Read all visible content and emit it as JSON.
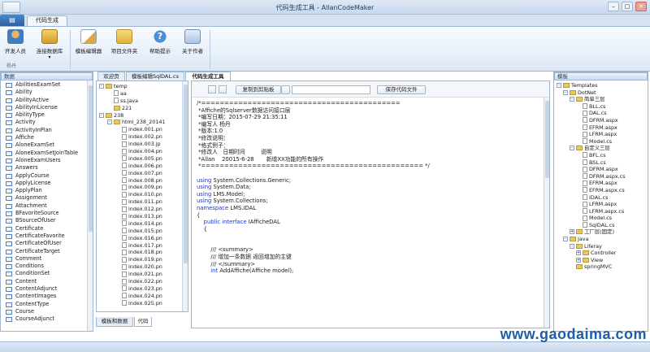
{
  "window": {
    "title": "代码生成工具 - AllanCodeMaker",
    "min": "–",
    "max": "□",
    "close": "✕"
  },
  "ribbon": {
    "tab": "代码生成",
    "buttons": [
      "开发人员",
      "连接数据库",
      "模板编辑器",
      "项目文件夹",
      "帮助提示",
      "关于作者"
    ],
    "group_label": "杨丹"
  },
  "left_panel": {
    "title": "数据",
    "items": [
      "AbilitiesExamSet",
      "Ability",
      "AbilityActive",
      "AbilityInLicense",
      "AbilityType",
      "Activity",
      "ActivityInPlan",
      "Affiche",
      "AloneExamSet",
      "AloneExamSetJoinTable",
      "AloneExamUsers",
      "Answers",
      "ApplyCourse",
      "ApplyLicense",
      "ApplyPlan",
      "Assignment",
      "Attachment",
      "BFavoriteSource",
      "BSourceOfUser",
      "Certificate",
      "CertificateFavorite",
      "CertificateOfUser",
      "CertificateTarget",
      "Comment",
      "Conditions",
      "ConditionSet",
      "Content",
      "ContentAdjunct",
      "ContentImages",
      "ContentType",
      "Course",
      "CourseAdjunct"
    ]
  },
  "doc_tabs": [
    "欢迎页",
    "模板编辑SqlDAL.cs",
    "代码生成工具"
  ],
  "file_tree": {
    "items": [
      {
        "label": "temp",
        "indent": 0,
        "kind": "folder",
        "exp": "-"
      },
      {
        "label": "aa",
        "indent": 1,
        "kind": "file",
        "exp": ""
      },
      {
        "label": "ss.java",
        "indent": 1,
        "kind": "file",
        "exp": ""
      },
      {
        "label": "221",
        "indent": 1,
        "kind": "folder",
        "exp": ""
      },
      {
        "label": "238",
        "indent": 0,
        "kind": "folder",
        "exp": "-"
      },
      {
        "label": "html_238_20141",
        "indent": 1,
        "kind": "folder",
        "exp": "-"
      },
      {
        "label": "index.001.pn",
        "indent": 2,
        "kind": "file",
        "exp": ""
      },
      {
        "label": "index.002.pn",
        "indent": 2,
        "kind": "file",
        "exp": ""
      },
      {
        "label": "index.003.jp",
        "indent": 2,
        "kind": "file",
        "exp": ""
      },
      {
        "label": "index.004.pn",
        "indent": 2,
        "kind": "file",
        "exp": ""
      },
      {
        "label": "index.005.pn",
        "indent": 2,
        "kind": "file",
        "exp": ""
      },
      {
        "label": "index.006.pn",
        "indent": 2,
        "kind": "file",
        "exp": ""
      },
      {
        "label": "index.007.pn",
        "indent": 2,
        "kind": "file",
        "exp": ""
      },
      {
        "label": "index.008.pn",
        "indent": 2,
        "kind": "file",
        "exp": ""
      },
      {
        "label": "index.009.pn",
        "indent": 2,
        "kind": "file",
        "exp": ""
      },
      {
        "label": "index.010.pn",
        "indent": 2,
        "kind": "file",
        "exp": ""
      },
      {
        "label": "index.011.pn",
        "indent": 2,
        "kind": "file",
        "exp": ""
      },
      {
        "label": "index.012.pn",
        "indent": 2,
        "kind": "file",
        "exp": ""
      },
      {
        "label": "index.013.pn",
        "indent": 2,
        "kind": "file",
        "exp": ""
      },
      {
        "label": "index.014.pn",
        "indent": 2,
        "kind": "file",
        "exp": ""
      },
      {
        "label": "index.015.pn",
        "indent": 2,
        "kind": "file",
        "exp": ""
      },
      {
        "label": "index.016.pn",
        "indent": 2,
        "kind": "file",
        "exp": ""
      },
      {
        "label": "index.017.pn",
        "indent": 2,
        "kind": "file",
        "exp": ""
      },
      {
        "label": "index.018.pn",
        "indent": 2,
        "kind": "file",
        "exp": ""
      },
      {
        "label": "index.019.pn",
        "indent": 2,
        "kind": "file",
        "exp": ""
      },
      {
        "label": "index.020.pn",
        "indent": 2,
        "kind": "file",
        "exp": ""
      },
      {
        "label": "index.021.pn",
        "indent": 2,
        "kind": "file",
        "exp": ""
      },
      {
        "label": "index.022.pn",
        "indent": 2,
        "kind": "file",
        "exp": ""
      },
      {
        "label": "index.023.pn",
        "indent": 2,
        "kind": "file",
        "exp": ""
      },
      {
        "label": "index.024.pn",
        "indent": 2,
        "kind": "file",
        "exp": ""
      },
      {
        "label": "index.025.pn",
        "indent": 2,
        "kind": "file",
        "exp": ""
      }
    ]
  },
  "editor_toolbar": {
    "copy_label": "复制到剪贴板",
    "save_label": "保存代码文件",
    "input_value": ""
  },
  "code_lines": [
    {
      "t": "/*===========================================",
      "c": "plain"
    },
    {
      "t": " *Affiche的Sqlserver数据访问接口层",
      "c": "plain"
    },
    {
      "t": " *编写日期：2015-07-29 21:35:11",
      "c": "plain"
    },
    {
      "t": " *编写人 杨丹",
      "c": "plain"
    },
    {
      "t": " *版本:1.0",
      "c": "plain"
    },
    {
      "t": " *修改说明：",
      "c": "plain"
    },
    {
      "t": " *格式例子：",
      "c": "plain"
    },
    {
      "t": " *修改人   日期时间         说明",
      "c": "plain"
    },
    {
      "t": " *Allan    20015-6-28       新增XX功能的所有操作",
      "c": "plain"
    },
    {
      "t": " *================================================ */",
      "c": "plain"
    },
    {
      "t": "",
      "c": "plain"
    },
    {
      "t": "using System.Collections.Generic;",
      "c": "using"
    },
    {
      "t": "using System.Data;",
      "c": "using"
    },
    {
      "t": "using LMS.Model;",
      "c": "using"
    },
    {
      "t": "using System.Collections;",
      "c": "using"
    },
    {
      "t": "namespace LMS.IDAL",
      "c": "ns"
    },
    {
      "t": "{",
      "c": "plain"
    },
    {
      "t": "    public interface IAfficheDAL",
      "c": "iface"
    },
    {
      "t": "    {",
      "c": "plain"
    },
    {
      "t": "",
      "c": "plain"
    },
    {
      "t": "",
      "c": "plain"
    },
    {
      "t": "        /// <summary>",
      "c": "plain"
    },
    {
      "t": "        /// 增加一条数据 返回增加的主键",
      "c": "plain"
    },
    {
      "t": "        /// </summary>",
      "c": "plain"
    },
    {
      "t": "        int AddAffiche(Affiche model);",
      "c": "int"
    }
  ],
  "bottom_tabs": [
    "模板和数据",
    "代码"
  ],
  "right_panel": {
    "title": "模板",
    "items": [
      {
        "label": "Templates",
        "indent": 0,
        "kind": "folder",
        "exp": "-"
      },
      {
        "label": "DotNet",
        "indent": 1,
        "kind": "folder",
        "exp": "-"
      },
      {
        "label": "简单三层",
        "indent": 2,
        "kind": "folder",
        "exp": "-"
      },
      {
        "label": "BLL.cs",
        "indent": 3,
        "kind": "file",
        "exp": ""
      },
      {
        "label": "DAL.cs",
        "indent": 3,
        "kind": "file",
        "exp": ""
      },
      {
        "label": "DFRM.aspx",
        "indent": 3,
        "kind": "file",
        "exp": ""
      },
      {
        "label": "EFRM.aspx",
        "indent": 3,
        "kind": "file",
        "exp": ""
      },
      {
        "label": "LFRM.aspx",
        "indent": 3,
        "kind": "file",
        "exp": ""
      },
      {
        "label": "Model.cs",
        "indent": 3,
        "kind": "file",
        "exp": ""
      },
      {
        "label": "自定义三层",
        "indent": 2,
        "kind": "folder",
        "exp": "-"
      },
      {
        "label": "BFL.cs",
        "indent": 3,
        "kind": "file",
        "exp": ""
      },
      {
        "label": "BSL.cs",
        "indent": 3,
        "kind": "file",
        "exp": ""
      },
      {
        "label": "DFRM.aspx",
        "indent": 3,
        "kind": "file",
        "exp": ""
      },
      {
        "label": "DFRM.aspx.cs",
        "indent": 3,
        "kind": "file",
        "exp": ""
      },
      {
        "label": "EFRM.aspx",
        "indent": 3,
        "kind": "file",
        "exp": ""
      },
      {
        "label": "EFRM.aspx.cs",
        "indent": 3,
        "kind": "file",
        "exp": ""
      },
      {
        "label": "IDAL.cs",
        "indent": 3,
        "kind": "file",
        "exp": ""
      },
      {
        "label": "LFRM.aspx",
        "indent": 3,
        "kind": "file",
        "exp": ""
      },
      {
        "label": "LFRM.aspx.cs",
        "indent": 3,
        "kind": "file",
        "exp": ""
      },
      {
        "label": "Model.cs",
        "indent": 3,
        "kind": "file",
        "exp": ""
      },
      {
        "label": "SqlDAL.cs",
        "indent": 3,
        "kind": "file",
        "exp": ""
      },
      {
        "label": "工厂层(固定)",
        "indent": 2,
        "kind": "folder",
        "exp": "+"
      },
      {
        "label": "Java",
        "indent": 1,
        "kind": "folder",
        "exp": "-"
      },
      {
        "label": "Liferay",
        "indent": 2,
        "kind": "folder",
        "exp": "-"
      },
      {
        "label": "Controller",
        "indent": 3,
        "kind": "folder",
        "exp": "+"
      },
      {
        "label": "View",
        "indent": 3,
        "kind": "folder",
        "exp": "+"
      },
      {
        "label": "springMVC",
        "indent": 2,
        "kind": "folder",
        "exp": ""
      }
    ]
  },
  "watermark": "www.gaodaima.com",
  "colors": {
    "keyword": "#1a35c9",
    "ribbon_bg": "#dde8f5",
    "border": "#9fb6d3"
  }
}
